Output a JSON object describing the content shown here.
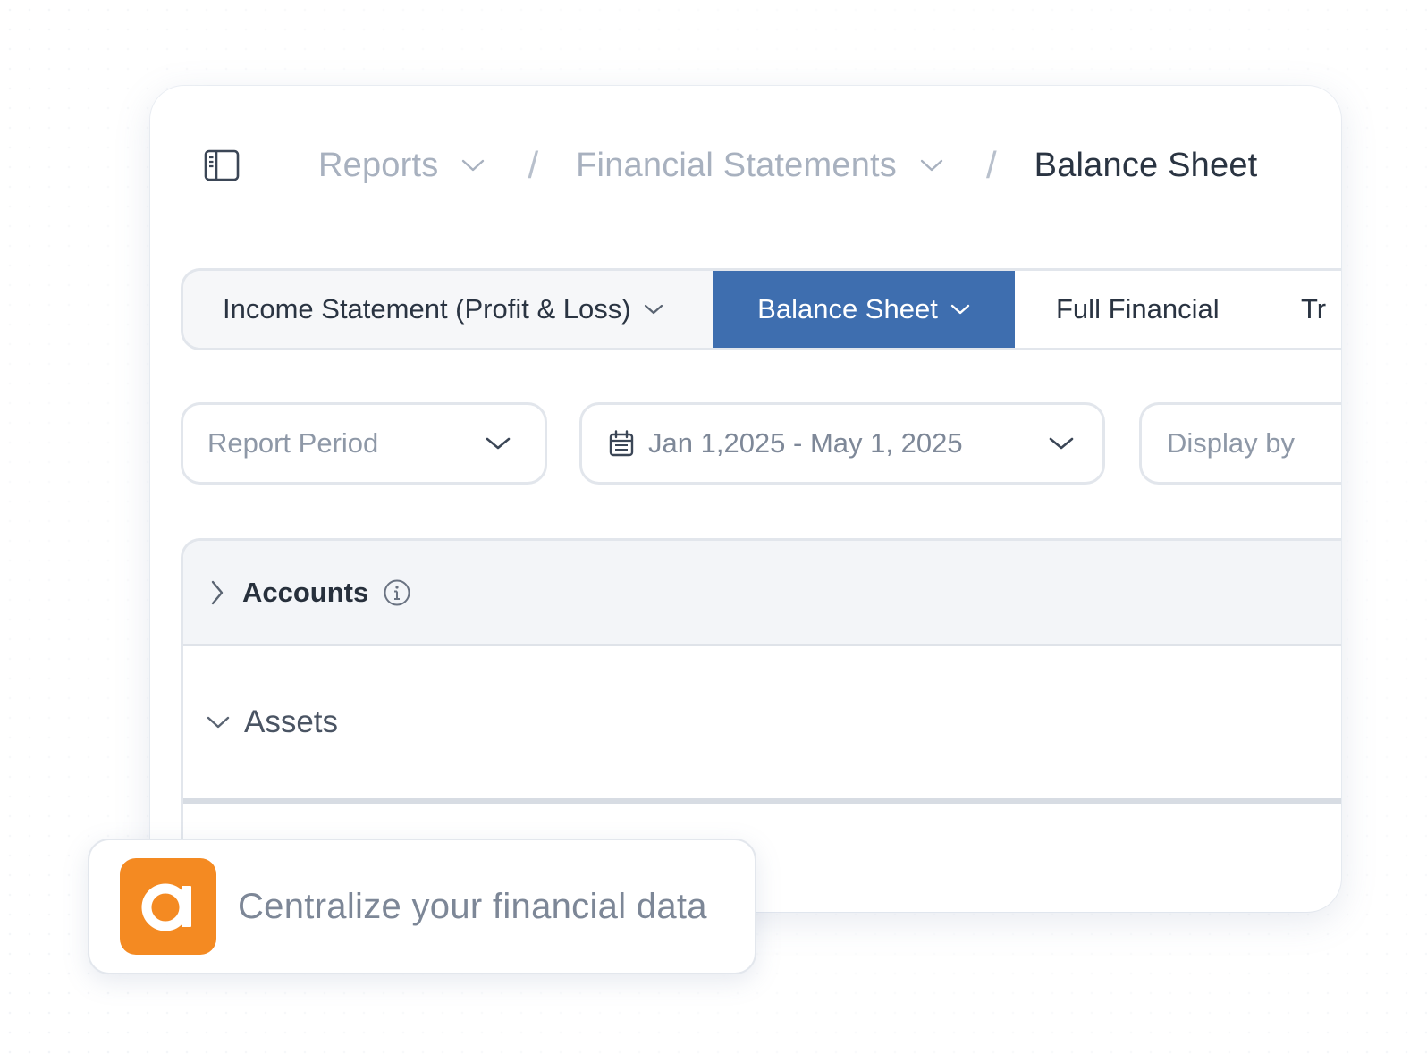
{
  "breadcrumb": {
    "items": [
      {
        "label": "Reports"
      },
      {
        "label": "Financial Statements"
      }
    ],
    "separator": "/",
    "current": "Balance Sheet"
  },
  "tabs": [
    {
      "label": "Income Statement (Profit & Loss)",
      "active": false
    },
    {
      "label": "Balance Sheet",
      "active": true
    },
    {
      "label": "Full Financial",
      "active": false
    },
    {
      "label": "Tr",
      "active": false
    }
  ],
  "filters": {
    "report_period": {
      "placeholder": "Report Period"
    },
    "date_range": {
      "value": "Jan 1,2025 - May 1, 2025"
    },
    "display_by": {
      "placeholder": "Display by"
    }
  },
  "table": {
    "header": {
      "label": "Accounts"
    },
    "sections": [
      {
        "label": "Assets",
        "expanded": true
      }
    ]
  },
  "badge": {
    "logo_letter": "a",
    "text": "Centralize your financial data"
  },
  "colors": {
    "accent": "#3e6eaf",
    "logo": "#f48a22",
    "text_dark": "#2a3442",
    "text_muted": "#a8b1bf"
  }
}
